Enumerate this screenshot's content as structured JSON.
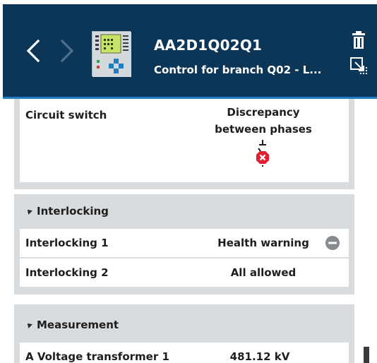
{
  "header": {
    "title": "AA2D1Q02Q1",
    "subtitle": "Control for branch Q02 - L...",
    "icons": {
      "back": "chevron-left-icon",
      "forward": "chevron-right-icon",
      "device": "bay-controller-icon",
      "delete": "trash-icon",
      "export": "export-icon"
    }
  },
  "circuit": {
    "label": "Circuit switch",
    "value_line1": "Discrepancy",
    "value_line2": "between phases",
    "status_icon": "switch-error-icon"
  },
  "interlocking": {
    "title": "Interlocking",
    "rows": [
      {
        "label": "Interlocking 1",
        "value": "Health warning",
        "icon": "minus-circle-icon"
      },
      {
        "label": "Interlocking 2",
        "value": "All allowed"
      }
    ]
  },
  "measurement": {
    "title": "Measurement",
    "rows": [
      {
        "label": "A Voltage transformer 1",
        "value": "481.12 kV"
      }
    ]
  },
  "colors": {
    "header_bg": "#0c3657",
    "accent": "#1f7ec4",
    "panel_bg": "#d9dcdf",
    "error": "#e0202e"
  }
}
